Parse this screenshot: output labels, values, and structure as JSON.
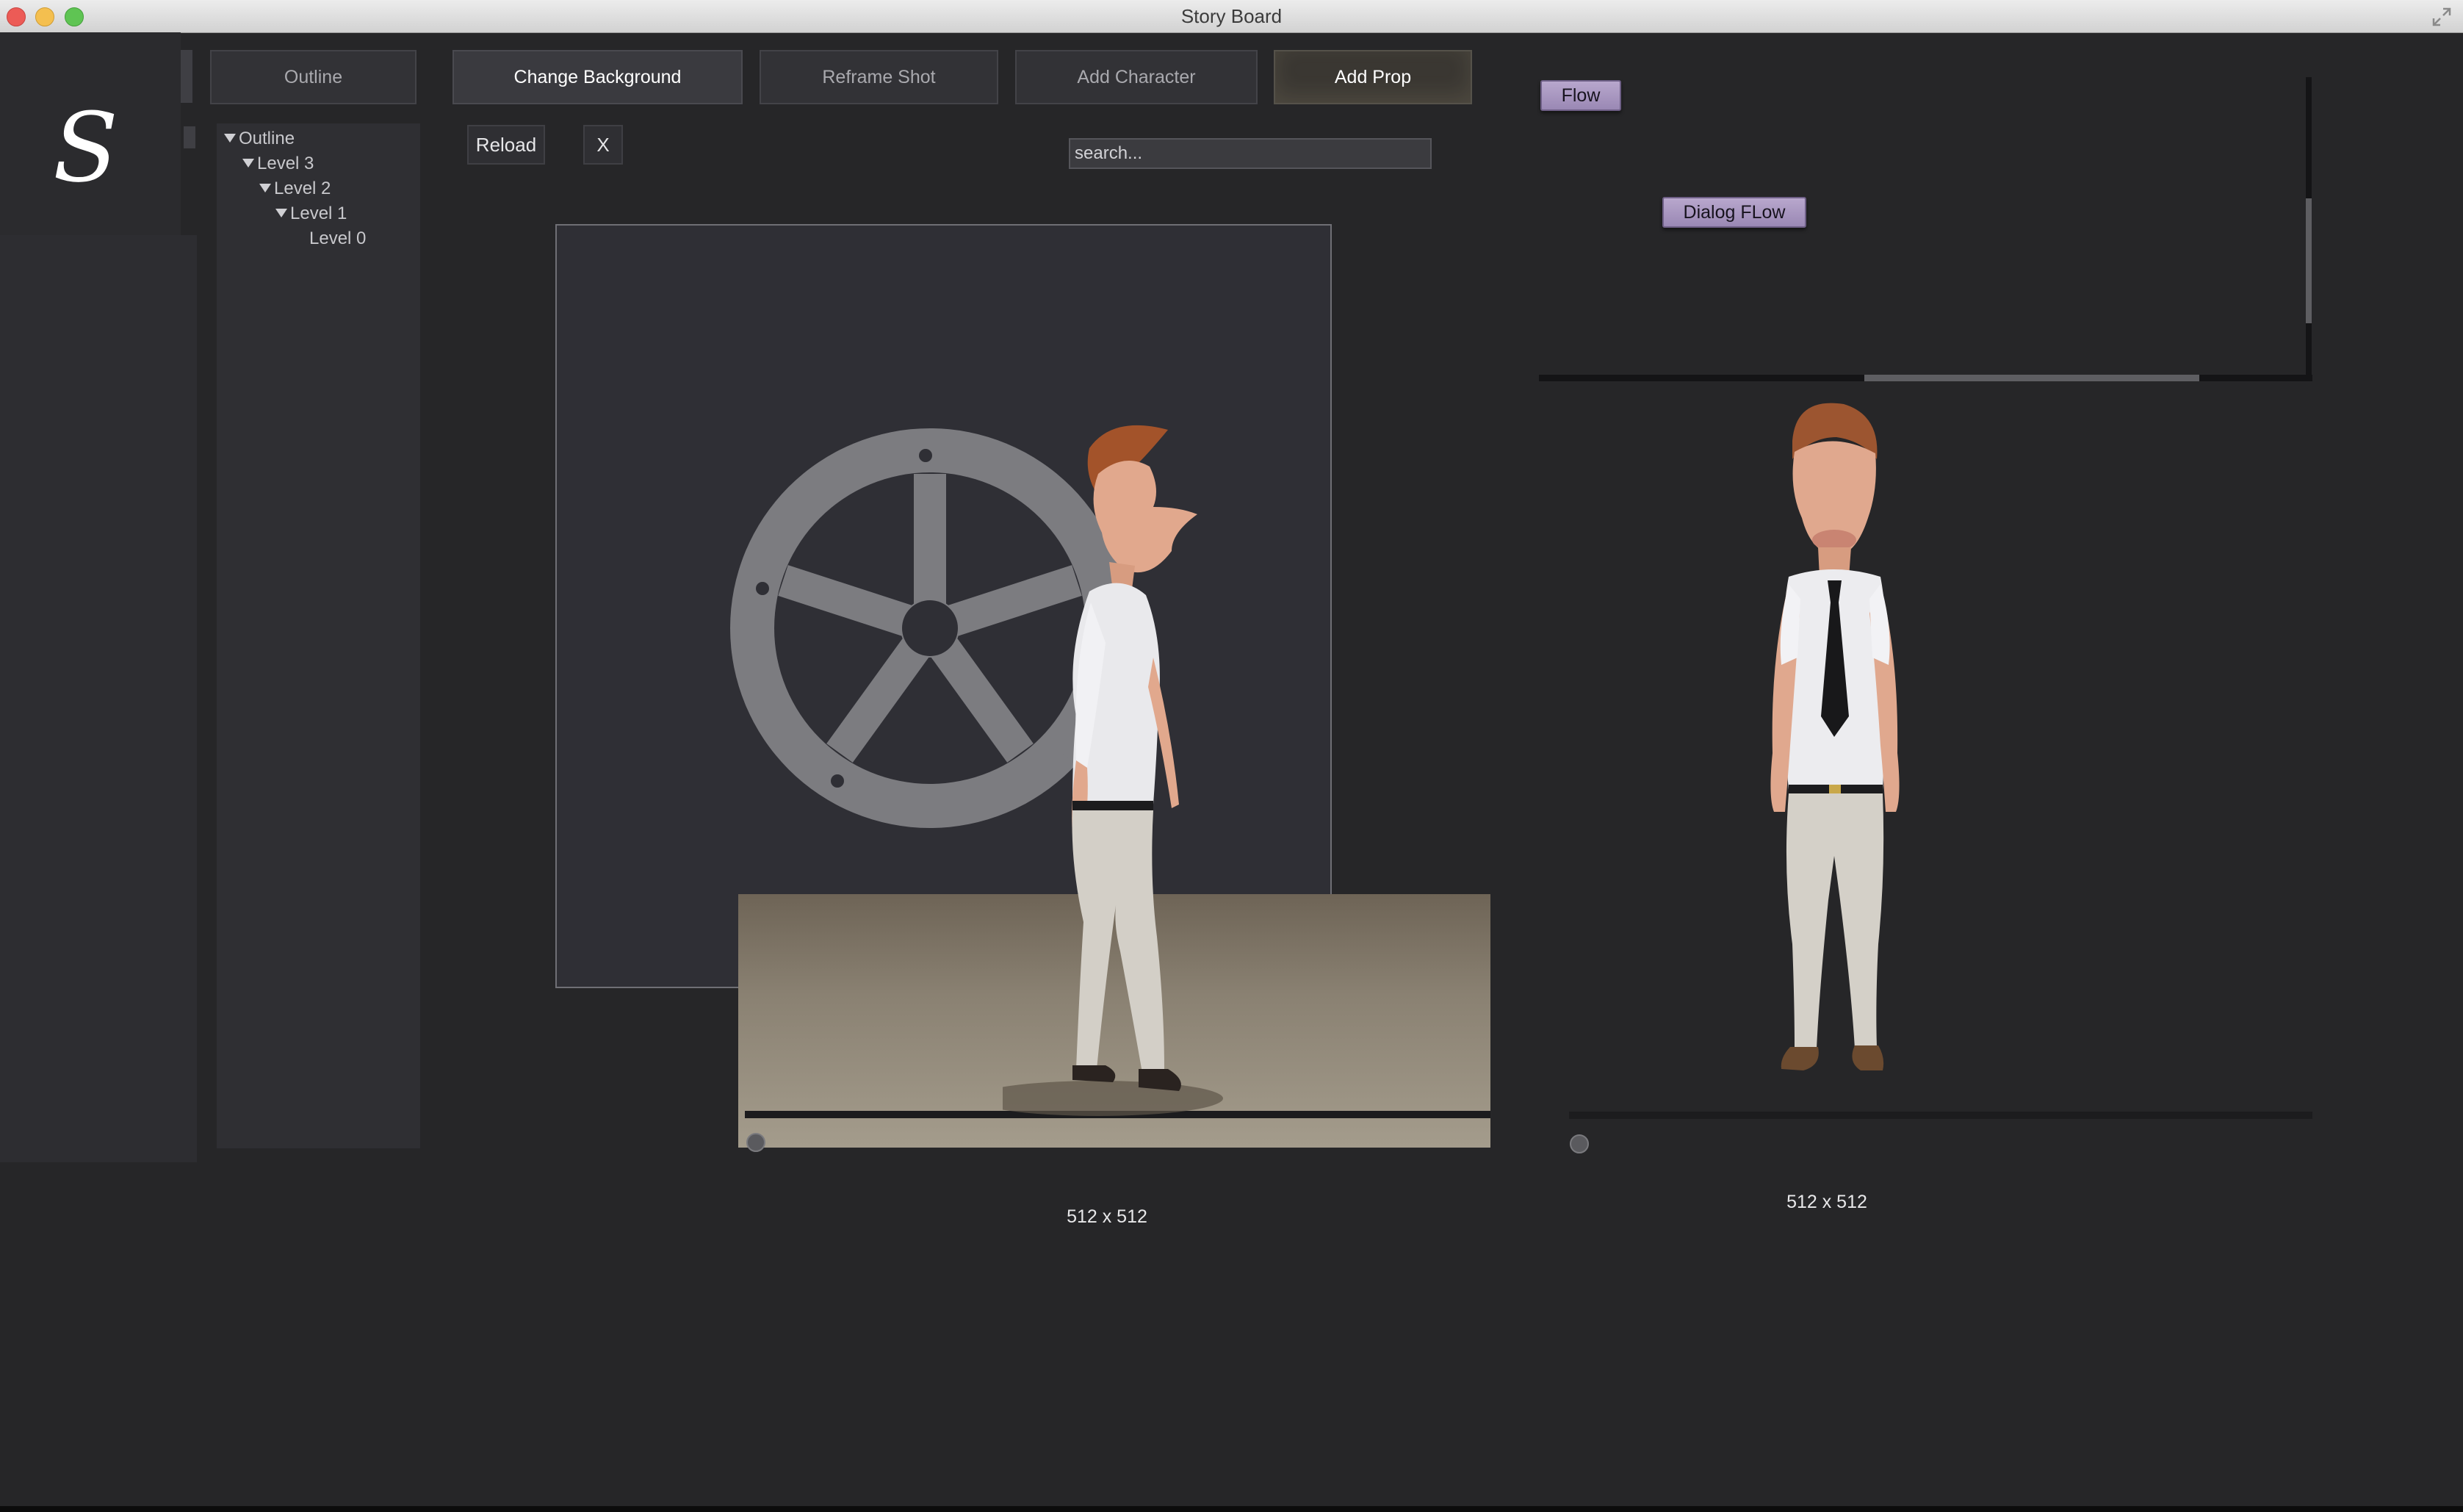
{
  "window": {
    "title": "Story Board"
  },
  "logo": {
    "glyph": "S"
  },
  "toolbar": {
    "outline_label": "Outline",
    "change_background_label": "Change Background",
    "reframe_shot_label": "Reframe Shot",
    "add_character_label": "Add Character",
    "add_prop_label": "Add Prop"
  },
  "controls": {
    "reload_label": "Reload",
    "close_label": "X",
    "search_placeholder": "search..."
  },
  "outline_tree": {
    "items": [
      {
        "label": "Outline",
        "expanded": true
      },
      {
        "label": "Level 3",
        "expanded": true
      },
      {
        "label": "Level 2",
        "expanded": true
      },
      {
        "label": "Level 1",
        "expanded": true
      },
      {
        "label": "Level 0",
        "expanded": false
      }
    ]
  },
  "viewport": {
    "dimensions_label": "512 x 512"
  },
  "flow_panel": {
    "flow_label": "Flow",
    "dialog_flow_label": "Dialog FLow"
  },
  "preview": {
    "dimensions_label": "512 x 512"
  },
  "colors": {
    "background": "#262628",
    "flow_button": "#a896c2",
    "stage_floor": "#8a8172"
  },
  "icons": [
    "close-window-icon",
    "minimize-window-icon",
    "zoom-window-icon",
    "fullscreen-icon",
    "disclosure-triangle-icon",
    "film-reel-icon"
  ]
}
